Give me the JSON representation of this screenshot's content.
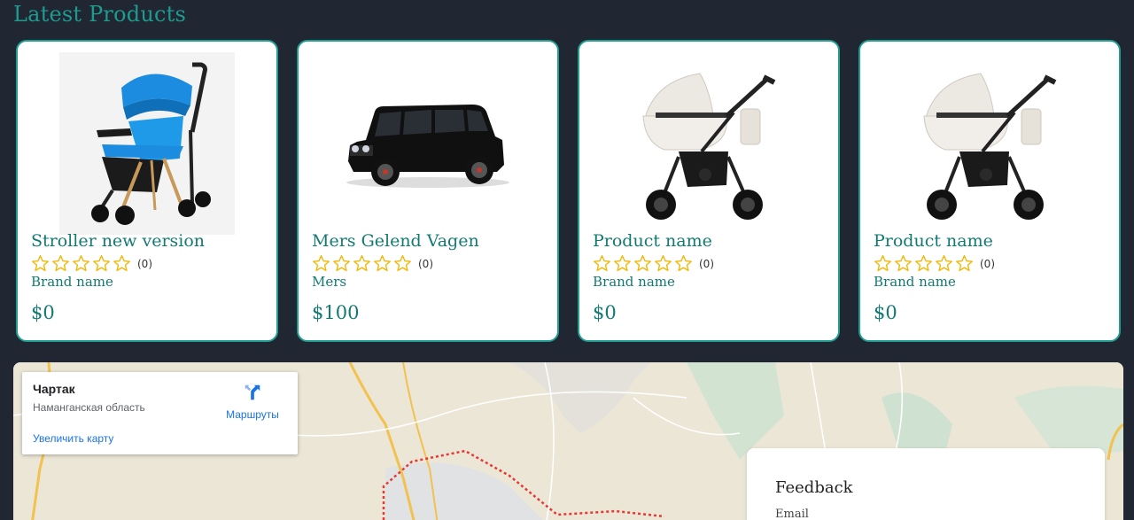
{
  "section": {
    "title": "Latest Products"
  },
  "products": [
    {
      "name": "Stroller new version",
      "rating_count": "(0)",
      "stars": 5,
      "brand": "Brand name",
      "price": "$0",
      "image": "stroller-blue-image"
    },
    {
      "name": "Mers Gelend Vagen",
      "rating_count": "(0)",
      "stars": 5,
      "brand": "Mers",
      "price": "$100",
      "image": "black-suv-image"
    },
    {
      "name": "Product name",
      "rating_count": "(0)",
      "stars": 5,
      "brand": "Brand name",
      "price": "$0",
      "image": "pram-white-image"
    },
    {
      "name": "Product name",
      "rating_count": "(0)",
      "stars": 5,
      "brand": "Brand name",
      "price": "$0",
      "image": "pram-white-image"
    }
  ],
  "map": {
    "place": "Чартак",
    "region": "Наманганская область",
    "directions_label": "Маршруты",
    "enlarge_label": "Увеличить карту"
  },
  "feedback": {
    "title": "Feedback",
    "email_label": "Email"
  },
  "colors": {
    "accent": "#1f9d91",
    "star": "#f2b705",
    "background": "#212732"
  }
}
